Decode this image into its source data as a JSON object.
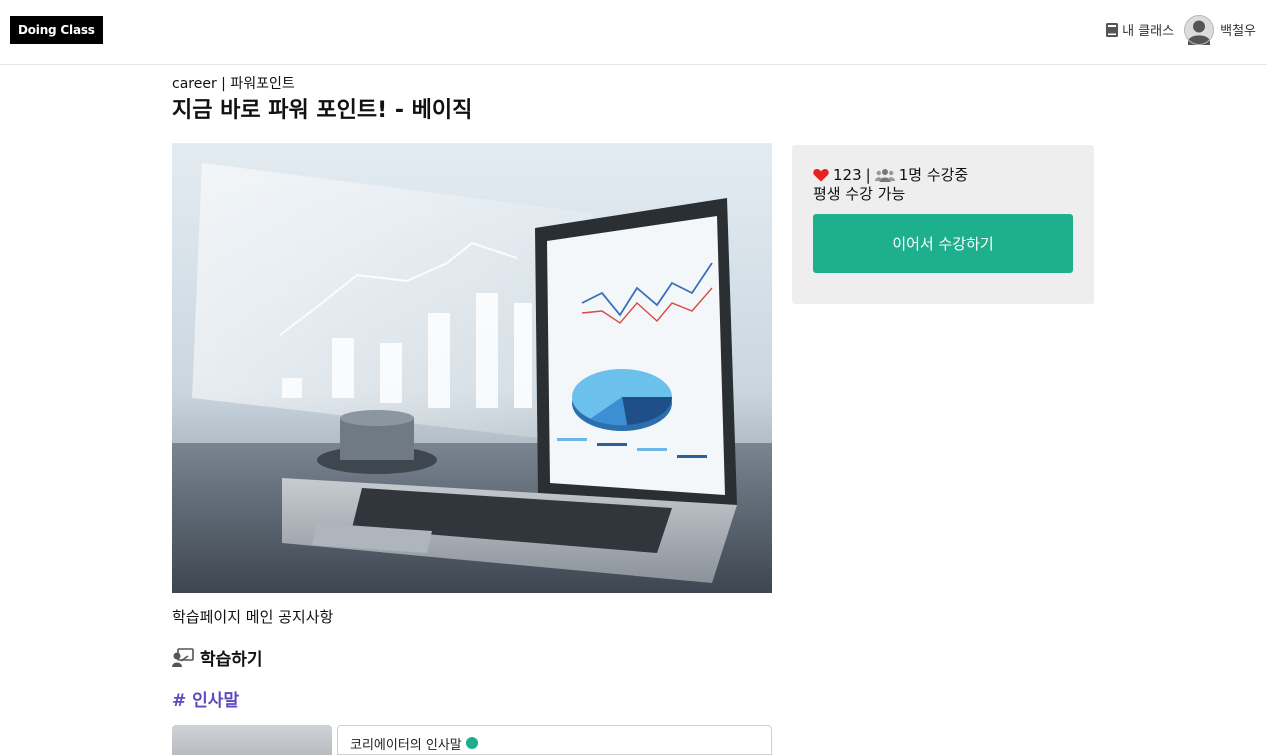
{
  "header": {
    "logo": "Doing Class",
    "my_class_label": "내 클래스",
    "user_name": "백철우"
  },
  "course": {
    "breadcrumb": "career | 파워포인트",
    "title": "지금 바로 파워 포인트! - 베이직",
    "notice": "학습페이지 메인 공지사항"
  },
  "side_panel": {
    "likes": "123",
    "separator": "|",
    "enrolled": "1명 수강중",
    "access": "평생 수강 가능",
    "cta_label": "이어서 수강하기"
  },
  "learning": {
    "heading": "학습하기",
    "section_tag": "# 인사말",
    "first_lesson": "코리에이터의 인사말"
  },
  "colors": {
    "accent": "#1eb08c",
    "section_tag": "#5b4bbd",
    "heart": "#e8201f"
  },
  "icons": [
    "book-icon",
    "avatar-icon",
    "heart-icon",
    "people-icon",
    "learn-icon",
    "check-icon"
  ]
}
